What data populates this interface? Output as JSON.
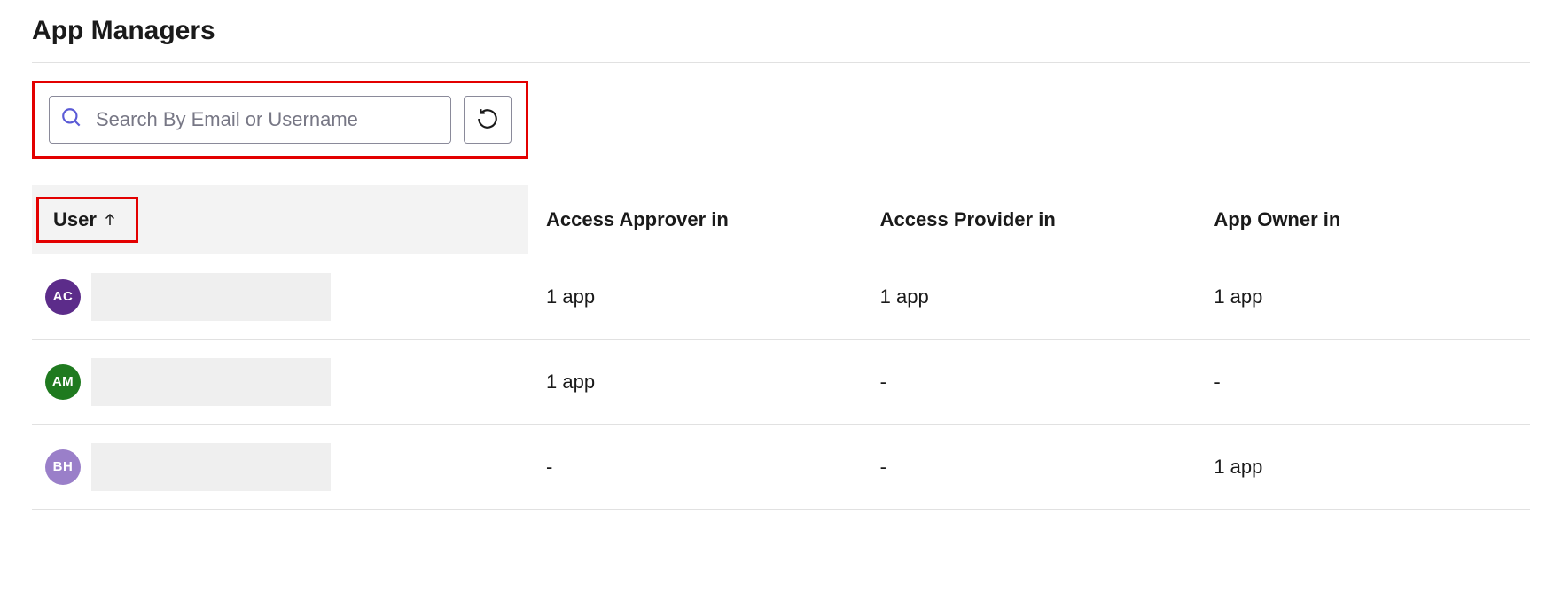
{
  "page_title": "App Managers",
  "search": {
    "placeholder": "Search By Email or Username"
  },
  "table": {
    "columns": {
      "user": "User",
      "access_approver": "Access Approver in",
      "access_provider": "Access Provider in",
      "app_owner": "App Owner in"
    },
    "sort": {
      "column": "user",
      "direction_icon": "arrow-up"
    },
    "rows": [
      {
        "avatar_initials": "AC",
        "avatar_color": "#5c2c8a",
        "access_approver": "1 app",
        "access_provider": "1 app",
        "app_owner": "1 app"
      },
      {
        "avatar_initials": "AM",
        "avatar_color": "#1f7a1f",
        "access_approver": "1 app",
        "access_provider": "-",
        "app_owner": "-"
      },
      {
        "avatar_initials": "BH",
        "avatar_color": "#9a7fc9",
        "access_approver": "-",
        "access_provider": "-",
        "app_owner": "1 app"
      }
    ]
  }
}
